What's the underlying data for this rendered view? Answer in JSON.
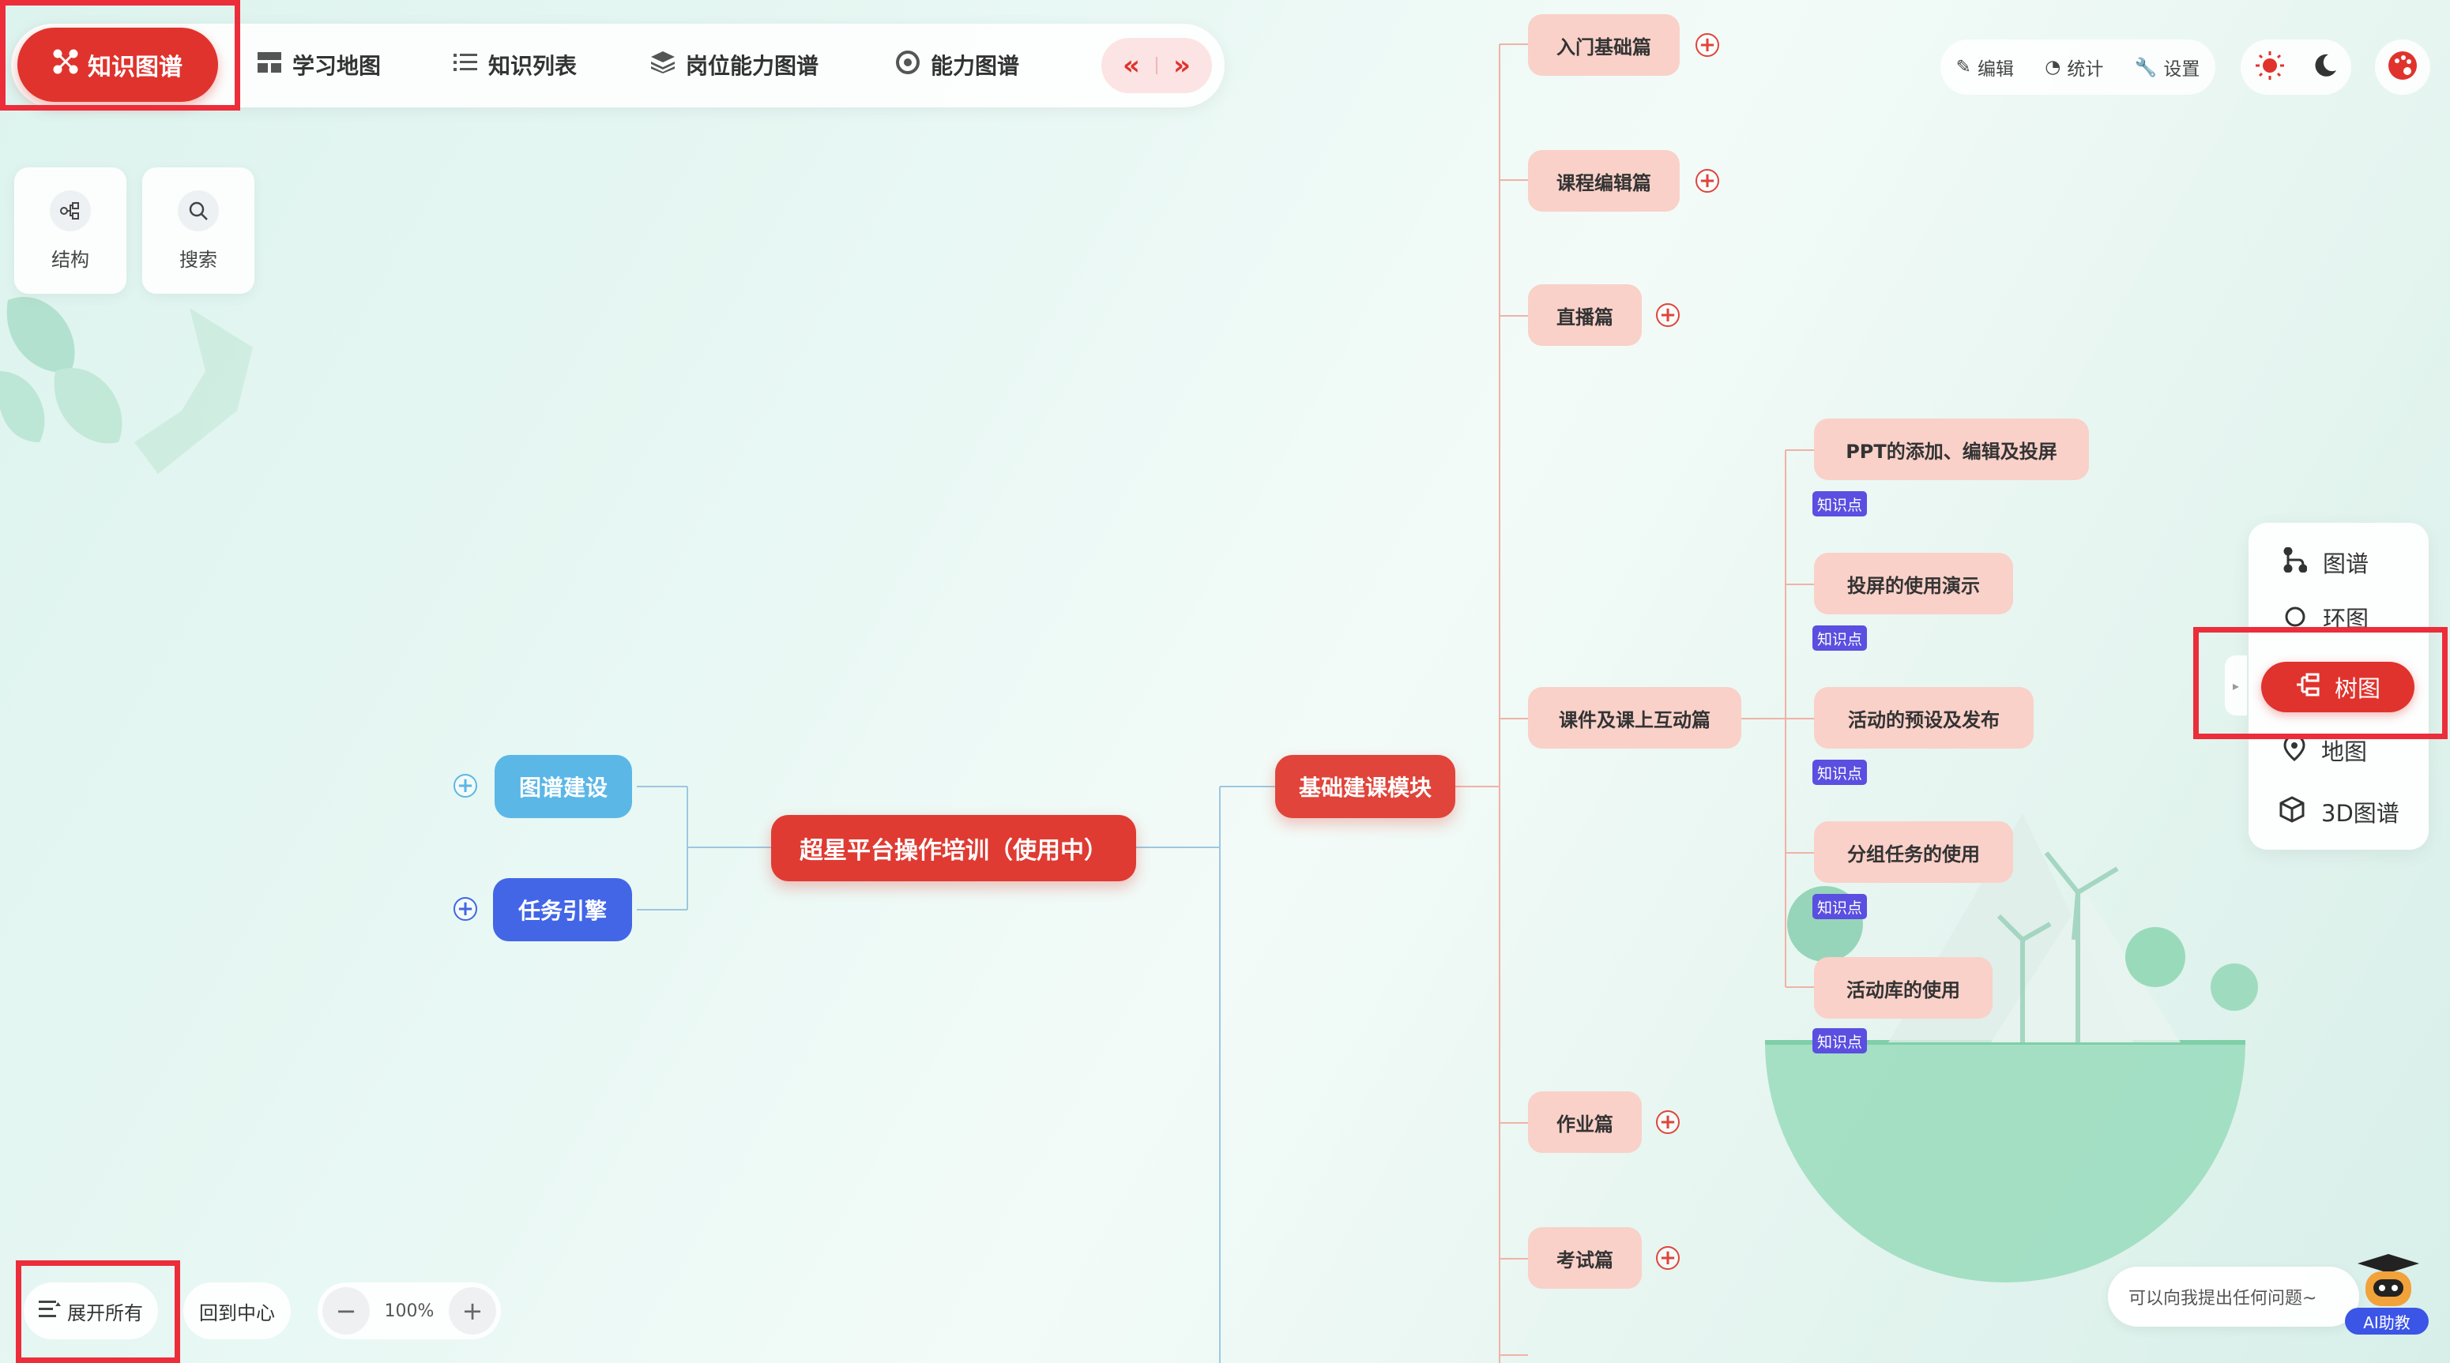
{
  "topnav": {
    "active": "知识图谱",
    "items": [
      "学习地图",
      "知识列表",
      "岗位能力图谱",
      "能力图谱"
    ],
    "arrow_left": "«",
    "arrow_right": "»"
  },
  "toolbar": {
    "edit": "编辑",
    "stats": "统计",
    "settings": "设置"
  },
  "left_tools": {
    "structure": "结构",
    "search": "搜索"
  },
  "mindmap": {
    "root": "超星平台操作培训（使用中）",
    "left_children": [
      "图谱建设",
      "任务引擎"
    ],
    "module": "基础建课模块",
    "chapters": [
      "入门基础篇",
      "课程编辑篇",
      "直播篇",
      "课件及课上互动篇",
      "作业篇",
      "考试篇"
    ],
    "knowledge_points": [
      "PPT的添加、编辑及投屏",
      "投屏的使用演示",
      "活动的预设及发布",
      "分组任务的使用",
      "活动库的使用"
    ],
    "badge_label": "知识点"
  },
  "view_switcher": {
    "items": [
      "图谱",
      "环图",
      "树图",
      "地图",
      "3D图谱"
    ],
    "active": "树图"
  },
  "bottom": {
    "expand_all": "展开所有",
    "back_center": "回到中心",
    "zoom_minus": "−",
    "zoom_level": "100%",
    "zoom_plus": "+"
  },
  "ai": {
    "prompt": "可以向我提出任何问题~",
    "label": "AI助教"
  },
  "colors": {
    "accent": "#e0332d",
    "node_pink": "#f9d1c9",
    "badge": "#5a4fe0",
    "blue_light": "#5bb7e6",
    "blue_dark": "#4266e6"
  }
}
